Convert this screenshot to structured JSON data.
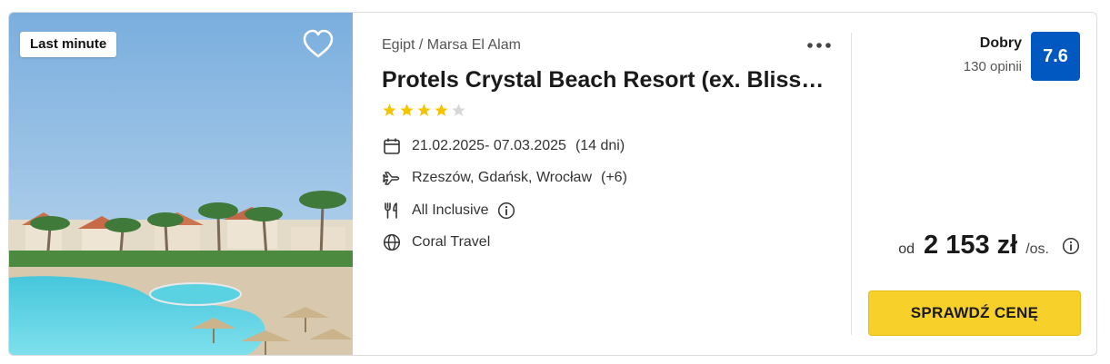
{
  "offer": {
    "badge": "Last minute",
    "location": "Egipt / Marsa El Alam",
    "title": "Protels Crystal Beach Resort (ex. Bliss…",
    "stars_rating": 4,
    "stars_max": 5,
    "dates": "21.02.2025- 07.03.2025",
    "duration": "(14 dni)",
    "departure": "Rzeszów, Gdańsk, Wrocław",
    "departure_extra": "(+6)",
    "board": "All Inclusive",
    "operator": "Coral Travel",
    "rating_word": "Dobry",
    "reviews": "130 opinii",
    "score": "7.6",
    "price_from": "od",
    "price": "2 153 zł",
    "price_unit": "/os.",
    "cta": "SPRAWDŹ CENĘ"
  },
  "colors": {
    "score_bg": "#0058c0",
    "cta_bg": "#f8d02a",
    "star": "#f5c400",
    "star_empty": "#d6d6d6"
  },
  "icons": [
    "heart-icon",
    "more-icon",
    "star-icon",
    "calendar-icon",
    "plane-icon",
    "cutlery-icon",
    "info-icon",
    "globe-icon"
  ]
}
